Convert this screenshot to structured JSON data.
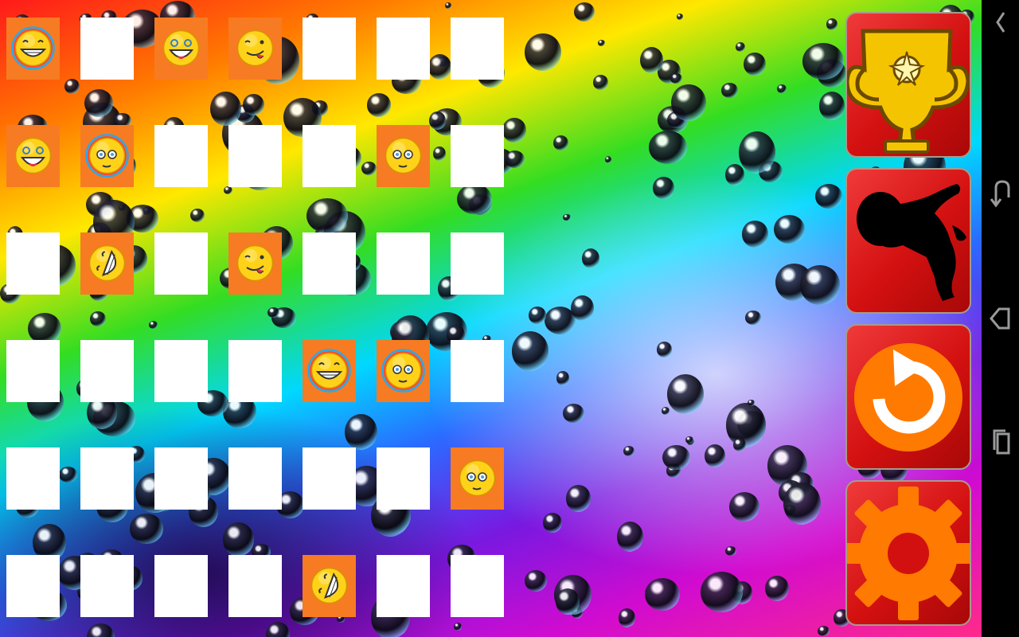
{
  "board": {
    "rows": 6,
    "cols": 7,
    "cards": [
      [
        "grin-rainbow",
        "closed",
        "laugh-teary",
        "tongue-wink",
        "closed",
        "closed",
        "closed"
      ],
      [
        "laugh-teary",
        "dizzy-rainbow",
        "closed",
        "closed",
        "closed",
        "dizzy",
        "closed"
      ],
      [
        "closed",
        "laugh-sideways",
        "closed",
        "tongue-wink",
        "closed",
        "closed",
        "closed"
      ],
      [
        "closed",
        "closed",
        "closed",
        "closed",
        "grin-rainbow",
        "dizzy-rainbow",
        "closed"
      ],
      [
        "closed",
        "closed",
        "closed",
        "closed",
        "closed",
        "closed",
        "dizzy"
      ],
      [
        "closed",
        "closed",
        "closed",
        "closed",
        "laugh-sideways",
        "closed",
        "closed"
      ]
    ]
  },
  "sidebar": {
    "buttons": [
      {
        "name": "trophy-button",
        "icon": "trophy-icon"
      },
      {
        "name": "silhouette-button",
        "icon": "child-silhouette-icon"
      },
      {
        "name": "restart-button",
        "icon": "restart-icon"
      },
      {
        "name": "settings-button",
        "icon": "gear-icon"
      }
    ]
  },
  "navbar": {
    "icons": [
      "chevron-left-icon",
      "back-icon",
      "home-icon",
      "recent-apps-icon"
    ]
  },
  "colors": {
    "card_open": "#f77b22",
    "card_closed": "#ffffff",
    "button_red": "#d31010",
    "accent_orange": "#ff7a00",
    "trophy_gold": "#f5c400"
  }
}
